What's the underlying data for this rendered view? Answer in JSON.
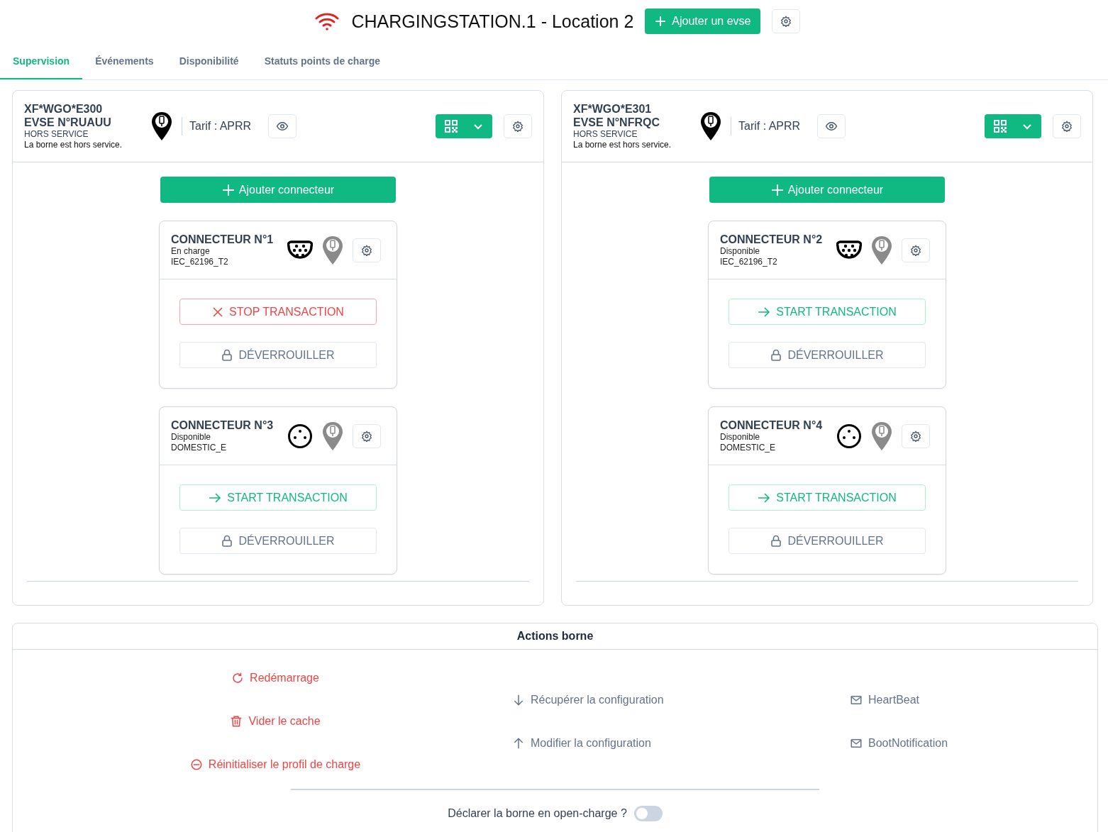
{
  "header": {
    "title": "CHARGINGSTATION.1 - Location 2",
    "connected": true,
    "add_button": "Ajouter un evse"
  },
  "tabs": [
    {
      "label": "Supervision",
      "selected": true
    },
    {
      "label": "Événements",
      "selected": false
    },
    {
      "label": "Disponibilité",
      "selected": false
    },
    {
      "label": "Statuts points de charge",
      "selected": false
    }
  ],
  "evses": [
    {
      "id": "XF*WGO*E300",
      "name": "EVSE N°RUAUU",
      "status": "HORS SERVICE",
      "description": "La borne est hors service.",
      "tariff": "Tarif : APRR",
      "add_connector": "Ajouter connecteur",
      "connectors": [
        {
          "title": "CONNECTEUR N°1",
          "status": "En charge",
          "type": "IEC_62196_T2",
          "kind": "type2",
          "action": {
            "kind": "stop",
            "label": "STOP TRANSACTION"
          },
          "unlock": "DÉVERROUILLER"
        },
        {
          "title": "CONNECTEUR N°3",
          "status": "Disponible",
          "type": "DOMESTIC_E",
          "kind": "domestic",
          "action": {
            "kind": "start",
            "label": "START TRANSACTION"
          },
          "unlock": "DÉVERROUILLER"
        }
      ]
    },
    {
      "id": "XF*WGO*E301",
      "name": "EVSE N°NFRQC",
      "status": "HORS SERVICE",
      "description": "La borne est hors service.",
      "tariff": "Tarif : APRR",
      "add_connector": "Ajouter connecteur",
      "connectors": [
        {
          "title": "CONNECTEUR N°2",
          "status": "Disponible",
          "type": "IEC_62196_T2",
          "kind": "type2",
          "action": {
            "kind": "start",
            "label": "START TRANSACTION"
          },
          "unlock": "DÉVERROUILLER"
        },
        {
          "title": "CONNECTEUR N°4",
          "status": "Disponible",
          "type": "DOMESTIC_E",
          "kind": "domestic",
          "action": {
            "kind": "start",
            "label": "START TRANSACTION"
          },
          "unlock": "DÉVERROUILLER"
        }
      ]
    }
  ],
  "actions_panel": {
    "title": "Actions borne",
    "columns": [
      [
        {
          "label": "Redémarrage",
          "kind": "restart",
          "danger": true
        },
        {
          "label": "Vider le cache",
          "kind": "trash",
          "danger": true
        },
        {
          "label": "Réinitialiser le profil de charge",
          "kind": "minus",
          "danger": true
        }
      ],
      [
        {
          "label": "Récupérer la configuration",
          "kind": "down",
          "danger": false
        },
        {
          "label": "Modifier la configuration",
          "kind": "up",
          "danger": false
        }
      ],
      [
        {
          "label": "HeartBeat",
          "kind": "mail",
          "danger": false
        },
        {
          "label": "BootNotification",
          "kind": "mail",
          "danger": false
        }
      ]
    ],
    "open_charge": {
      "label": "Déclarer la borne en open-charge ?",
      "on": false
    }
  }
}
